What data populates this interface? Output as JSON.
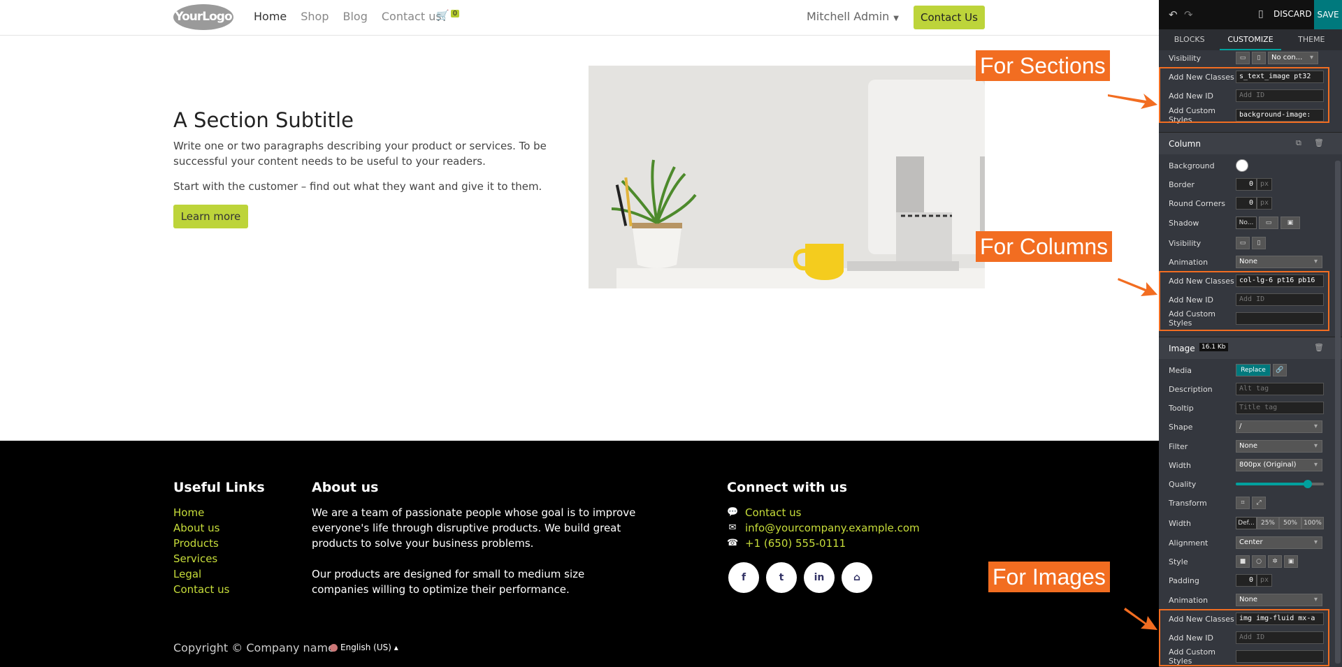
{
  "nav": {
    "logo": "YourLogo",
    "links": [
      "Home",
      "Shop",
      "Blog",
      "Contact us"
    ],
    "cart_count": "0",
    "user": "Mitchell Admin",
    "contact_button": "Contact Us"
  },
  "hero": {
    "subtitle": "A Section Subtitle",
    "para1": "Write one or two paragraphs describing your product or services. To be successful your content needs to be useful to your readers.",
    "para2": "Start with the customer – find out what they want and give it to them.",
    "button": "Learn more"
  },
  "footer": {
    "useful_links_title": "Useful Links",
    "useful_links": [
      "Home",
      "About us",
      "Products",
      "Services",
      "Legal",
      "Contact us"
    ],
    "about_title": "About us",
    "about_p1": "We are a team of passionate people whose goal is to improve everyone's life through disruptive products. We build great products to solve your business problems.",
    "about_p2": "Our products are designed for small to medium size companies willing to optimize their performance.",
    "connect_title": "Connect with us",
    "connect": [
      "Contact us",
      "info@yourcompany.example.com",
      "+1 (650) 555-0111"
    ],
    "social": [
      "f",
      "t",
      "in",
      "⌂"
    ],
    "copyright": "Copyright © Company name",
    "language": "English (US)"
  },
  "callouts": {
    "sections": "For Sections",
    "columns": "For Columns",
    "images": "For Images"
  },
  "panel": {
    "discard": "DISCARD",
    "save": "SAVE",
    "tabs": [
      "BLOCKS",
      "CUSTOMIZE",
      "THEME"
    ],
    "section": {
      "visibility_label": "Visibility",
      "visibility_value": "No con...",
      "classes_label": "Add New Classes",
      "classes_value": "s_text_image pt32",
      "id_label": "Add New ID",
      "id_placeholder": "Add ID",
      "styles_label": "Add Custom Styles",
      "styles_value": "background-image:"
    },
    "column": {
      "title": "Column",
      "background": "Background",
      "border": "Border",
      "border_value": "0",
      "round_corners": "Round Corners",
      "round_value": "0",
      "px": "px",
      "shadow": "Shadow",
      "shadow_value": "No...",
      "visibility": "Visibility",
      "animation": "Animation",
      "animation_value": "None",
      "classes_label": "Add New Classes",
      "classes_value": "col-lg-6 pt16 pb16",
      "id_label": "Add New ID",
      "id_placeholder": "Add ID",
      "styles_label": "Add Custom Styles",
      "styles_value": ""
    },
    "image": {
      "title": "Image",
      "size": "16.1 Kb",
      "media": "Media",
      "replace": "Replace",
      "description": "Description",
      "description_ph": "Alt tag",
      "tooltip": "Tooltip",
      "tooltip_ph": "Title tag",
      "shape": "Shape",
      "shape_value": "/",
      "filter": "Filter",
      "filter_value": "None",
      "width": "Width",
      "width_value": "800px (Original)",
      "quality": "Quality",
      "quality_level": 0.82,
      "transform": "Transform",
      "width2": "Width",
      "width_options": [
        "Def...",
        "25%",
        "50%",
        "100%"
      ],
      "alignment": "Alignment",
      "alignment_value": "Center",
      "style": "Style",
      "padding": "Padding",
      "padding_value": "0",
      "animation": "Animation",
      "animation_value": "None",
      "classes_label": "Add New Classes",
      "classes_value": "img img-fluid mx-a",
      "id_label": "Add New ID",
      "id_placeholder": "Add ID",
      "styles_label": "Add Custom Styles",
      "styles_value": ""
    }
  },
  "colors": {
    "accent": "#bdd43a",
    "callout": "#f26d21",
    "save": "#00797d"
  }
}
